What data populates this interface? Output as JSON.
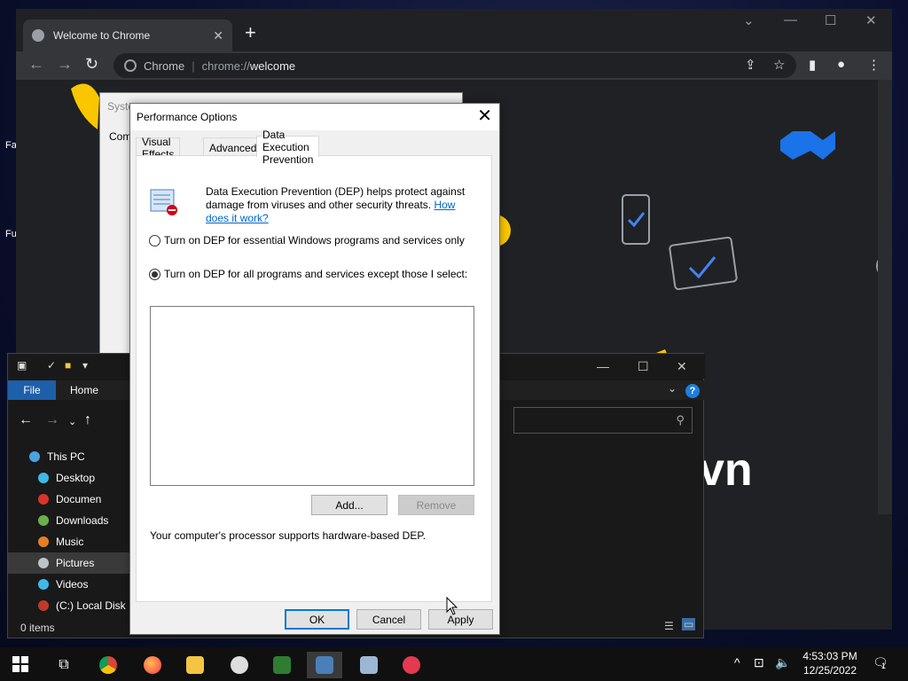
{
  "chrome": {
    "tab_title": "Welcome to Chrome",
    "omnibox_site": "Chrome",
    "omnibox_scheme": "chrome://",
    "omnibox_path": "welcome",
    "page_brand_text": "vn"
  },
  "desktop": {
    "labels": [
      "Fa",
      "Fu"
    ]
  },
  "sysprops": {
    "title_partial": "Syste",
    "tab_partial": "Com"
  },
  "explorer": {
    "menu_file": "File",
    "menu_home": "Home",
    "tree": [
      {
        "label": "This PC",
        "color": "#4aa3df"
      },
      {
        "label": "Desktop",
        "color": "#3fb8e8"
      },
      {
        "label": "Documen",
        "color": "#d9342b"
      },
      {
        "label": "Downloads",
        "color": "#6ab04c"
      },
      {
        "label": "Music",
        "color": "#e67e22"
      },
      {
        "label": "Pictures",
        "color": "#bdc3c7"
      },
      {
        "label": "Videos",
        "color": "#3fb8e8"
      },
      {
        "label": "(C:) Local Disk",
        "color": "#c0392b"
      }
    ],
    "status": "0 items",
    "help_glyph": "?"
  },
  "dialog": {
    "title": "Performance Options",
    "tabs": [
      "Visual Effects",
      "Advanced",
      "Data Execution Prevention"
    ],
    "description": "Data Execution Prevention (DEP) helps protect against damage from viruses and other security threats.",
    "link": "How does it work?",
    "radio_essential": "Turn on DEP for essential Windows programs and services only",
    "radio_all": "Turn on DEP for all programs and services except those I select:",
    "btn_add": "Add...",
    "btn_remove": "Remove",
    "support_text": "Your computer's processor supports hardware-based DEP.",
    "btn_ok": "OK",
    "btn_cancel": "Cancel",
    "btn_apply": "Apply"
  },
  "taskbar": {
    "time": "4:53:03 PM",
    "date": "12/25/2022",
    "notification_count": "1"
  },
  "colors": {
    "accent": "#0078d7",
    "chrome_dark": "#202124",
    "link": "#0066cc"
  }
}
